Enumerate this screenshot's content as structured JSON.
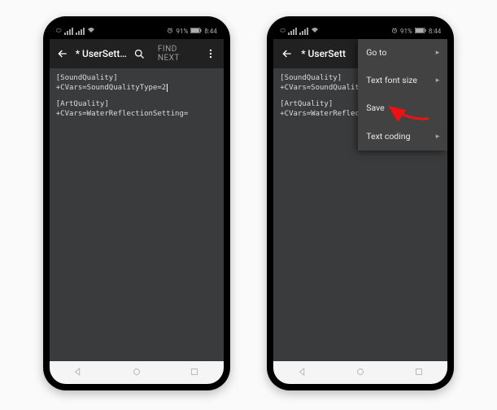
{
  "status": {
    "battery": "91%",
    "time": "8:44",
    "alarm_icon": "⏰"
  },
  "appbar": {
    "title": "* UserSett…",
    "title_right": "* UserSett",
    "find_next": "FIND NEXT"
  },
  "editor": {
    "line1": "[SoundQuality]",
    "line2_left": "+CVars=SoundQualityType=2",
    "line2_right": "+CVars=SoundQualityTyp",
    "line3": "[ArtQuality]",
    "line4_left": "+CVars=WaterReflectionSetting=",
    "line4_right": "+CVars=WaterReflection"
  },
  "menu": {
    "goto": "Go to",
    "fontsize": "Text font size",
    "save": "Save",
    "coding": "Text coding"
  }
}
